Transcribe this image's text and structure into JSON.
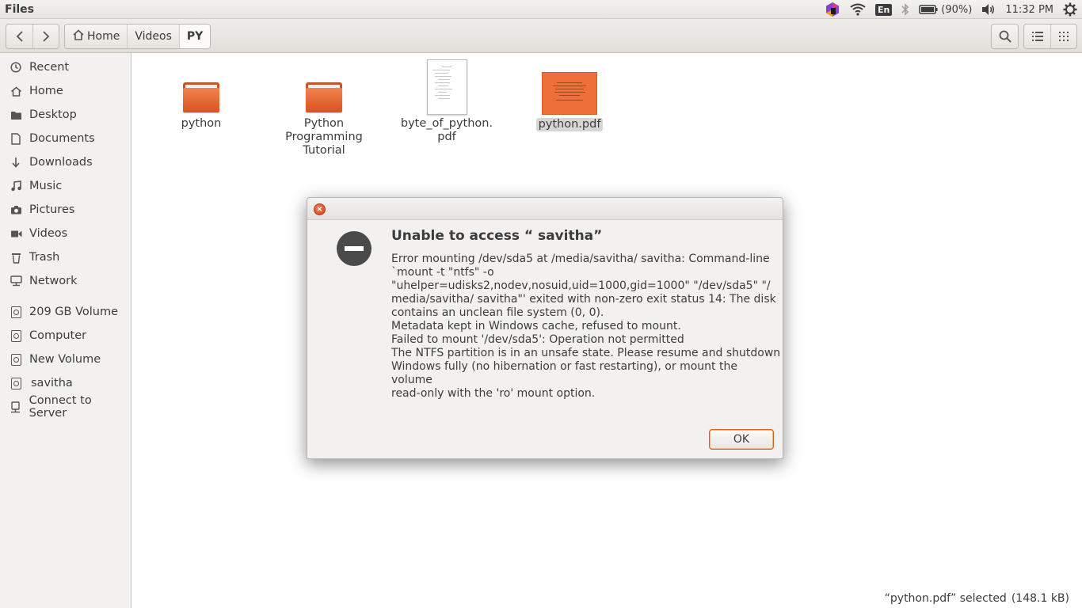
{
  "top_panel": {
    "app_title": "Files",
    "battery": "(90%)",
    "language": "En",
    "time": "11:32 PM"
  },
  "toolbar": {
    "breadcrumbs": [
      "Home",
      "Videos",
      "PY"
    ]
  },
  "sidebar": {
    "places": [
      "Recent",
      "Home",
      "Desktop",
      "Documents",
      "Downloads",
      "Music",
      "Pictures",
      "Videos",
      "Trash",
      "Network"
    ],
    "devices": [
      "209 GB Volume",
      "Computer",
      "New Volume",
      "savitha",
      "Connect to Server"
    ]
  },
  "files": [
    {
      "name_lines": [
        "python"
      ]
    },
    {
      "name_lines": [
        "Python",
        "Programming",
        "Tutorial"
      ]
    },
    {
      "name_lines": [
        "byte_of_python.",
        "pdf"
      ]
    },
    {
      "name_lines": [
        "python.pdf"
      ]
    }
  ],
  "status": {
    "selection": "“python.pdf” selected",
    "size": "(148.1 kB)"
  },
  "dialog": {
    "title": "Unable to access “ savitha”",
    "lines": [
      "Error mounting /dev/sda5 at /media/savitha/ savitha: Command-line",
      "`mount -t \"ntfs\" -o",
      "\"uhelper=udisks2,nodev,nosuid,uid=1000,gid=1000\" \"/dev/sda5\" \"/",
      "media/savitha/ savitha\"' exited with non-zero exit status 14: The disk",
      "contains an unclean file system (0, 0).",
      "Metadata kept in Windows cache, refused to mount.",
      "Failed to mount '/dev/sda5': Operation not permitted",
      "The NTFS partition is in an unsafe state. Please resume and shutdown",
      "Windows fully (no hibernation or fast restarting), or mount the",
      "volume",
      "read-only with the 'ro' mount option."
    ],
    "ok_label": "OK"
  }
}
